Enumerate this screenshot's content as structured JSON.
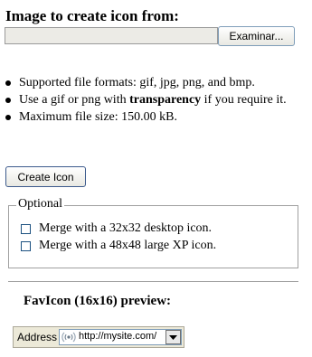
{
  "header": {
    "title": "Image to create icon from:"
  },
  "file": {
    "value": "",
    "browse_label": "Examinar..."
  },
  "info": {
    "items": [
      {
        "text": "Supported file formats: gif, jpg, png, and bmp."
      },
      {
        "before": "Use a gif or png with ",
        "bold": "transparency",
        "after": " if you require it."
      },
      {
        "text": "Maximum file size: 150.00 kB."
      }
    ]
  },
  "actions": {
    "create_label": "Create Icon"
  },
  "optional": {
    "legend": "Optional",
    "options": [
      {
        "label": "Merge with a 32x32 desktop icon.",
        "checked": false
      },
      {
        "label": "Merge with a 48x48 large XP icon.",
        "checked": false
      }
    ]
  },
  "preview": {
    "title": "FavIcon (16x16) preview:",
    "address_label": "Address",
    "url": "http://mysite.com/",
    "favicon": "wifi-signal-icon"
  }
}
